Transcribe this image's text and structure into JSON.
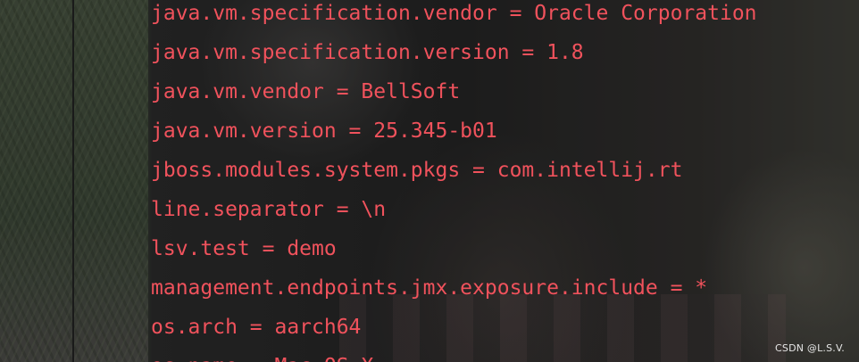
{
  "editor": {
    "lines": [
      "java.vm.specification.vendor = Oracle Corporation",
      "java.vm.specification.version = 1.8",
      "java.vm.vendor = BellSoft",
      "java.vm.version = 25.345-b01",
      "jboss.modules.system.pkgs = com.intellij.rt",
      "line.separator = \\n",
      "lsv.test = demo",
      "management.endpoints.jmx.exposure.include = *",
      "os.arch = aarch64",
      "os.name = Mac OS X"
    ],
    "text_color": "#f0525c"
  },
  "watermark": "CSDN @L.S.V."
}
